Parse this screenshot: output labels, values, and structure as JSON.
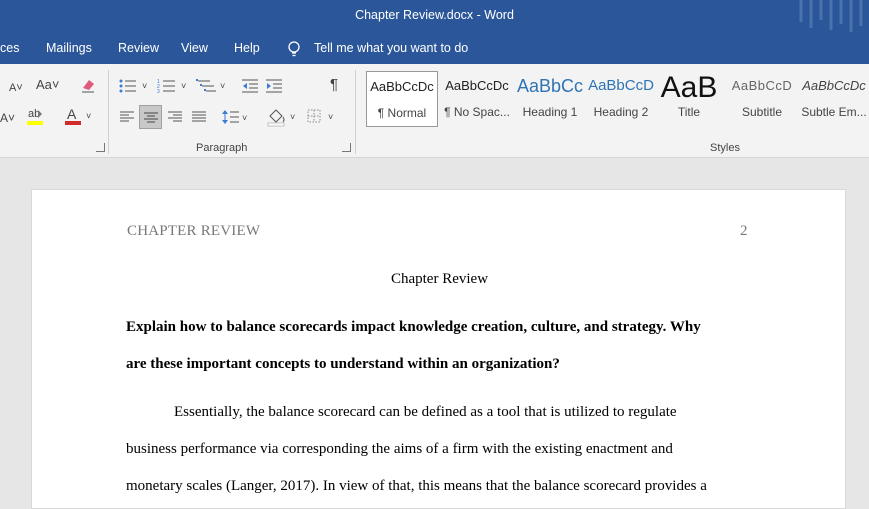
{
  "window": {
    "title": "Chapter Review.docx  -  Word"
  },
  "menu": {
    "items": [
      "ces",
      "Mailings",
      "Review",
      "View",
      "Help"
    ],
    "tell_me": "Tell me what you want to do"
  },
  "ribbon": {
    "paragraph_label": "Paragraph",
    "styles_label": "Styles",
    "font_aa": "Aa",
    "styles": [
      {
        "sample": "AaBbCcDc",
        "label": "¶ Normal"
      },
      {
        "sample": "AaBbCcDc",
        "label": "¶ No Spac..."
      },
      {
        "sample": "AaBbCc",
        "label": "Heading 1"
      },
      {
        "sample": "AaBbCcD",
        "label": "Heading 2"
      },
      {
        "sample": "AaB",
        "label": "Title"
      },
      {
        "sample": "AaBbCcD",
        "label": "Subtitle"
      },
      {
        "sample": "AaBbCcDc",
        "label": "Subtle Em..."
      }
    ]
  },
  "document": {
    "header_left": "CHAPTER REVIEW",
    "header_right": "2",
    "title": "Chapter Review",
    "question_lines": [
      "Explain how to balance scorecards impact knowledge creation, culture, and strategy. Why",
      "are these important concepts to understand within an organization?"
    ],
    "body_lines": [
      "Essentially, the balance scorecard can be defined as a tool that is utilized to regulate",
      "business performance via corresponding the aims of a firm with the existing enactment and",
      "monetary scales (Langer, 2017). In view of that, this means that the balance scorecard provides a"
    ]
  },
  "colors": {
    "title_bar": "#2b579a",
    "ribbon": "#f3f3f3",
    "canvas": "#e6e6e6"
  }
}
